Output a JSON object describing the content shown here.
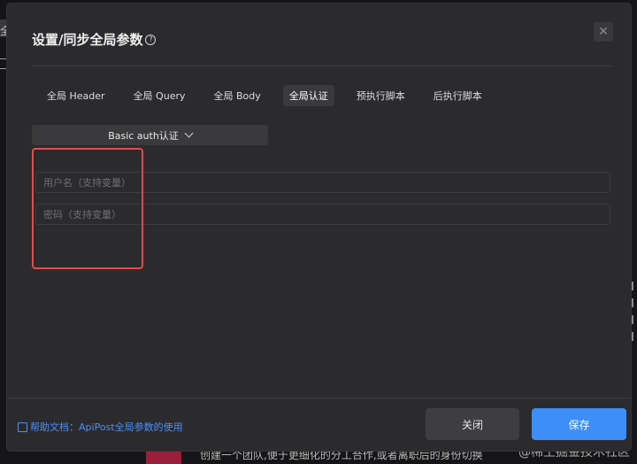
{
  "background": {
    "left_fragment": "全",
    "bottom_text": "创建一个团队,便于更细化的分工合作,或者离职后的身份切换",
    "watermark": "@稀土掘金技术社区"
  },
  "dialog": {
    "title": "设置/同步全局参数",
    "help_glyph": "?",
    "close_glyph": "✕",
    "tabs": [
      {
        "label": "全局 Header",
        "active": false
      },
      {
        "label": "全局 Query",
        "active": false
      },
      {
        "label": "全局 Body",
        "active": false
      },
      {
        "label": "全局认证",
        "active": true
      },
      {
        "label": "预执行脚本",
        "active": false
      },
      {
        "label": "后执行脚本",
        "active": false
      }
    ],
    "auth_type": {
      "selected": "Basic auth认证"
    },
    "fields": {
      "username_placeholder": "用户名（支持变量）",
      "password_placeholder": "密码（支持变量）"
    },
    "footer": {
      "help_link": "帮助文档：ApiPost全局参数的使用",
      "close_label": "关闭",
      "save_label": "保存"
    }
  },
  "colors": {
    "accent": "#3d8ef7",
    "highlight_box": "#e04d4d",
    "dialog_bg": "#2b2b2e"
  }
}
